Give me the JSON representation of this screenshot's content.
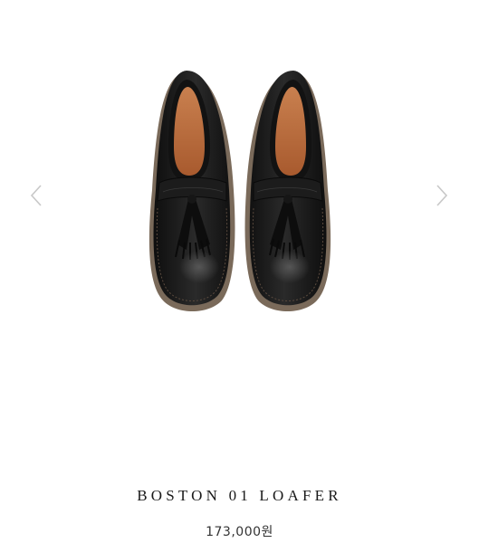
{
  "gallery": {
    "prev_icon": "chevron-left-icon",
    "next_icon": "chevron-right-icon",
    "image_subject": "black leather tassel loafers, top view"
  },
  "product": {
    "name": "BOSTON 01 LOAFER",
    "price": "173,000원"
  },
  "colors": {
    "background": "#ffffff",
    "arrow": "#c8c8c8",
    "leather": "#1b1b1b",
    "lining": "#b8673a",
    "text": "#1a1a1a"
  }
}
